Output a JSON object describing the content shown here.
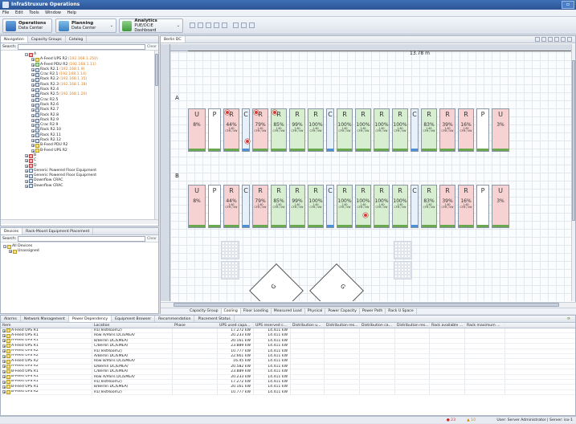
{
  "app": {
    "title": "InfraStruxure Operations"
  },
  "menu": [
    "File",
    "Edit",
    "Tools",
    "Window",
    "Help"
  ],
  "perspectives": [
    {
      "title": "Operations",
      "subtitle": "Data Center"
    },
    {
      "title": "Planning",
      "subtitle": "Data Center"
    },
    {
      "title": "Analytics",
      "subtitle": "PUE/DCiE Dashboard"
    }
  ],
  "nav": {
    "tabs": [
      "Navigation",
      "Capacity Groups",
      "Catalog"
    ],
    "search_label": "Search:",
    "clear_label": "Clear",
    "tree": [
      {
        "label": "A",
        "ip": "",
        "icon": "r",
        "indent": 0
      },
      {
        "label": "A-Feed UPS R2",
        "ip": "(192.168.1.250)",
        "icon": "y",
        "indent": 1
      },
      {
        "label": "A-Feed PDU R2",
        "ip": "(192.168.1.11)",
        "icon": "g",
        "indent": 1
      },
      {
        "label": "Rack R2.1",
        "ip": "(192.168.1.9)",
        "icon": "b",
        "indent": 1
      },
      {
        "label": "Crac R2.1",
        "ip": "(192.168.1.14)",
        "icon": "b",
        "indent": 1
      },
      {
        "label": "Rack R2.2",
        "ip": "(192.168.1.15)",
        "icon": "b",
        "indent": 1
      },
      {
        "label": "Rack R2.3",
        "ip": "(192.168.1.18)",
        "icon": "b",
        "indent": 1
      },
      {
        "label": "Rack R2.4",
        "ip": "",
        "icon": "b",
        "indent": 1
      },
      {
        "label": "Rack R2.5",
        "ip": "(192.168.1.20)",
        "icon": "b",
        "indent": 1
      },
      {
        "label": "Crac R2.5",
        "ip": "",
        "icon": "b",
        "indent": 1
      },
      {
        "label": "Rack R2.6",
        "ip": "",
        "icon": "b",
        "indent": 1
      },
      {
        "label": "Rack R2.7",
        "ip": "",
        "icon": "b",
        "indent": 1
      },
      {
        "label": "Rack R2.8",
        "ip": "",
        "icon": "b",
        "indent": 1
      },
      {
        "label": "Rack R2.9",
        "ip": "",
        "icon": "b",
        "indent": 1
      },
      {
        "label": "Crac R2.9",
        "ip": "",
        "icon": "b",
        "indent": 1
      },
      {
        "label": "Rack R2.10",
        "ip": "",
        "icon": "b",
        "indent": 1
      },
      {
        "label": "Rack R2.11",
        "ip": "",
        "icon": "b",
        "indent": 1
      },
      {
        "label": "Rack R2.12",
        "ip": "",
        "icon": "b",
        "indent": 1
      },
      {
        "label": "B-Feed PDU R2",
        "ip": "",
        "icon": "y",
        "indent": 1
      },
      {
        "label": "B-Feed UPS R2",
        "ip": "",
        "icon": "y",
        "indent": 1
      },
      {
        "label": "B",
        "ip": "",
        "icon": "r",
        "indent": 0
      },
      {
        "label": "C",
        "ip": "",
        "icon": "r",
        "indent": 0
      },
      {
        "label": "D",
        "ip": "",
        "icon": "r",
        "indent": 0
      },
      {
        "label": "Generic Powered Floor Equipment",
        "ip": "",
        "icon": "b",
        "indent": 0
      },
      {
        "label": "Generic Powered Floor Equipment",
        "ip": "",
        "icon": "b",
        "indent": 0
      },
      {
        "label": "Downflow CRAC",
        "ip": "",
        "icon": "b",
        "indent": 0
      },
      {
        "label": "Downflow CRAC",
        "ip": "",
        "icon": "b",
        "indent": 0
      }
    ]
  },
  "devices": {
    "tabs": [
      "Devices",
      "Rack-Mount Equipment Placement"
    ],
    "search_label": "Search:",
    "clear_label": "Clear",
    "tree": [
      "All Devices",
      "Unassigned"
    ]
  },
  "editor": {
    "tab": "Berlin DC",
    "dimension": "13.78 m",
    "row_a_label": "A",
    "row_b_label": "B",
    "row_a": [
      {
        "t": "U",
        "pct": "8%",
        "color": "pink",
        "bar": "#6aa84f"
      },
      {
        "t": "P",
        "pct": "",
        "color": "white",
        "bar": "#6aa84f"
      },
      {
        "t": "R",
        "pct": "44%",
        "color": "pink",
        "bar": "#6aa84f",
        "sub": "1.60",
        "alarm": false,
        "badge": true
      },
      {
        "t": "C",
        "pct": "",
        "color": "bl",
        "bar": "#4a90d9"
      },
      {
        "t": "R",
        "pct": "79%",
        "color": "pink",
        "bar": "#6aa84f",
        "sub": "1.60",
        "badge": true
      },
      {
        "t": "R",
        "pct": "85%",
        "color": "green",
        "bar": "#6aa84f",
        "sub": "1.60",
        "badge": true
      },
      {
        "t": "R",
        "pct": "99%",
        "color": "green",
        "bar": "#6aa84f",
        "sub": "1.60"
      },
      {
        "t": "R",
        "pct": "100%",
        "color": "green",
        "bar": "#6aa84f",
        "sub": "1.60"
      },
      {
        "t": "C",
        "pct": "",
        "color": "bl",
        "bar": "#4a90d9"
      },
      {
        "t": "R",
        "pct": "100%",
        "color": "green",
        "bar": "#6aa84f",
        "sub": "1.60"
      },
      {
        "t": "R",
        "pct": "100%",
        "color": "green",
        "bar": "#6aa84f",
        "sub": "1.60"
      },
      {
        "t": "R",
        "pct": "100%",
        "color": "green",
        "bar": "#6aa84f",
        "sub": "1.60"
      },
      {
        "t": "R",
        "pct": "100%",
        "color": "green",
        "bar": "#6aa84f",
        "sub": "1.60"
      },
      {
        "t": "C",
        "pct": "",
        "color": "bl",
        "bar": "#4a90d9"
      },
      {
        "t": "R",
        "pct": "83%",
        "color": "green",
        "bar": "#6aa84f",
        "sub": "1.60"
      },
      {
        "t": "R",
        "pct": "39%",
        "color": "pink",
        "bar": "#6aa84f",
        "sub": "1.60"
      },
      {
        "t": "R",
        "pct": "16%",
        "color": "pink",
        "bar": "#6aa84f",
        "sub": "1.60"
      },
      {
        "t": "P",
        "pct": "",
        "color": "white",
        "bar": "#6aa84f"
      },
      {
        "t": "U",
        "pct": "3%",
        "color": "pink",
        "bar": "#6aa84f"
      }
    ],
    "row_b": [
      {
        "t": "U",
        "pct": "8%",
        "color": "pink",
        "bar": "#6aa84f"
      },
      {
        "t": "P",
        "pct": "",
        "color": "white",
        "bar": "#6aa84f"
      },
      {
        "t": "R",
        "pct": "44%",
        "color": "pink",
        "bar": "#6aa84f",
        "sub": "1.60"
      },
      {
        "t": "C",
        "pct": "",
        "color": "bl",
        "bar": "#4a90d9"
      },
      {
        "t": "R",
        "pct": "79%",
        "color": "pink",
        "bar": "#6aa84f",
        "sub": "1.60"
      },
      {
        "t": "R",
        "pct": "85%",
        "color": "green",
        "bar": "#6aa84f",
        "sub": "1.60"
      },
      {
        "t": "R",
        "pct": "99%",
        "color": "green",
        "bar": "#6aa84f",
        "sub": "1.60"
      },
      {
        "t": "R",
        "pct": "100%",
        "color": "green",
        "bar": "#6aa84f",
        "sub": "1.60"
      },
      {
        "t": "C",
        "pct": "",
        "color": "bl",
        "bar": "#4a90d9"
      },
      {
        "t": "R",
        "pct": "100%",
        "color": "green",
        "bar": "#6aa84f",
        "sub": "1.60"
      },
      {
        "t": "R",
        "pct": "100%",
        "color": "green",
        "bar": "#6aa84f",
        "sub": "1.60"
      },
      {
        "t": "R",
        "pct": "100%",
        "color": "green",
        "bar": "#6aa84f",
        "sub": "1.60"
      },
      {
        "t": "R",
        "pct": "100%",
        "color": "green",
        "bar": "#6aa84f",
        "sub": "1.60"
      },
      {
        "t": "C",
        "pct": "",
        "color": "bl",
        "bar": "#4a90d9"
      },
      {
        "t": "R",
        "pct": "83%",
        "color": "green",
        "bar": "#6aa84f",
        "sub": "1.60"
      },
      {
        "t": "R",
        "pct": "39%",
        "color": "pink",
        "bar": "#6aa84f",
        "sub": "1.60"
      },
      {
        "t": "R",
        "pct": "16%",
        "color": "pink",
        "bar": "#6aa84f",
        "sub": "1.60"
      },
      {
        "t": "P",
        "pct": "",
        "color": "white",
        "bar": "#6aa84f"
      },
      {
        "t": "U",
        "pct": "3%",
        "color": "pink",
        "bar": "#6aa84f"
      }
    ],
    "rack_sub_label": "CFM / kW",
    "floor_label": "G",
    "view_tabs": [
      "Capacity Group",
      "Cooling",
      "Floor Loading",
      "Measured Load",
      "Physical",
      "Power Capacity",
      "Power Path",
      "Rack U Space"
    ]
  },
  "bottom": {
    "tabs": [
      "Alarms",
      "Network Management",
      "Power Dependency",
      "Equipment Browser",
      "Recommendation",
      "Placement Status"
    ],
    "columns": [
      "Item",
      "Location",
      "Phase",
      "UPS used capa...",
      "UPS reserved c...",
      "Distribution u...",
      "Distribution res...",
      "Distribution ca...",
      "Distribution res...",
      "Rack available ...",
      "Rack maximum ..."
    ],
    "rows": [
      [
        "A-Feed UPS R1",
        "R1(TestRoom2)",
        "",
        "17.272 kW",
        "14.411 kW"
      ],
      [
        "A-Feed UPS R1",
        "Row A/Paris DC/EMEA/",
        "",
        "20.233 kW",
        "14.411 kW"
      ],
      [
        "A-Feed UPS R1",
        "B/Berlin DC/EMEA/",
        "",
        "20.161 kW",
        "14.411 kW"
      ],
      [
        "A-Feed UPS R1",
        "C/Berlin DC/EMEA/",
        "",
        "23.889 kW",
        "14.411 kW"
      ],
      [
        "A-Feed UPS R2",
        "R1(TestRoom2)",
        "",
        "10.777 kW",
        "14.411 kW"
      ],
      [
        "A-Feed UPS R2",
        "A/Berlin DC/EMEA/",
        "",
        "22.661 kW",
        "14.411 kW"
      ],
      [
        "A-Feed UPS R2",
        "Row B/Paris DC/EMEA/",
        "",
        "16.45 kW",
        "14.411 kW"
      ],
      [
        "A-Feed UPS R2",
        "D/Berlin DC/EMEA/",
        "",
        "20.582 kW",
        "14.411 kW"
      ],
      [
        "B-Feed UPS R1",
        "C/Berlin DC/EMEA/",
        "",
        "23.889 kW",
        "14.411 kW"
      ],
      [
        "B-Feed UPS R1",
        "Row A/Paris DC/EMEA/",
        "",
        "20.233 kW",
        "14.411 kW"
      ],
      [
        "B-Feed UPS R1",
        "R1(TestRoom2)",
        "",
        "17.272 kW",
        "14.411 kW"
      ],
      [
        "B-Feed UPS R1",
        "B/Berlin DC/EMEA/",
        "",
        "20.161 kW",
        "14.411 kW"
      ],
      [
        "B-Feed UPS R2",
        "R1(TestRoom2)",
        "",
        "10.777 kW",
        "14.411 kW"
      ]
    ]
  },
  "status": {
    "alarm_count": "23",
    "warning_count": "10",
    "user": "User: Server Administrator | Server: isx-1"
  }
}
